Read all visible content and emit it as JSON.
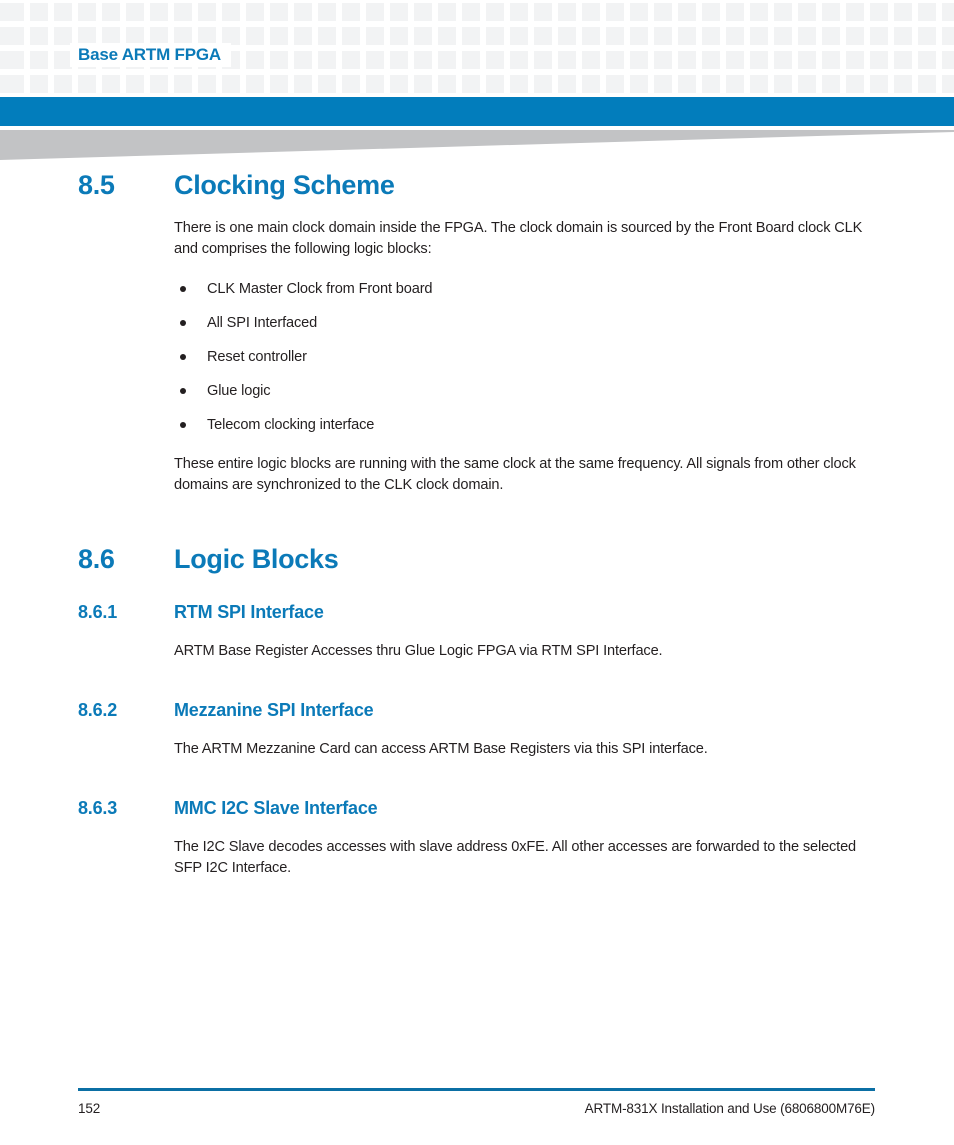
{
  "document": {
    "header": {
      "running_title": "Base ARTM FPGA"
    },
    "footer": {
      "page_number": "152",
      "doc_info": "ARTM-831X Installation and Use (6806800M76E)"
    },
    "colors": {
      "heading_blue": "#0b7ab8",
      "header_bar_blue": "#027dbc",
      "footer_rule_blue": "#0b6fa4",
      "wedge_gray": "#c2c3c5",
      "pattern_gray": "#f2f3f4",
      "body_text": "#231f20"
    },
    "sections": [
      {
        "number": "8.5",
        "title": "Clocking Scheme",
        "intro": "There is one main clock domain inside the FPGA. The clock domain is sourced by the Front Board clock CLK and comprises the following logic blocks:",
        "bullets": [
          "CLK Master Clock from Front board",
          "All SPI Interfaced",
          "Reset controller",
          "Glue logic",
          "Telecom clocking interface"
        ],
        "outro": "These entire logic blocks are running with the same clock at the same frequency. All signals from other clock domains are synchronized to the CLK clock domain."
      },
      {
        "number": "8.6",
        "title": "Logic Blocks",
        "subsections": [
          {
            "number": "8.6.1",
            "title": "RTM SPI Interface",
            "body": "ARTM Base Register Accesses thru Glue Logic FPGA via RTM SPI Interface."
          },
          {
            "number": "8.6.2",
            "title": "Mezzanine SPI Interface",
            "body": "The ARTM Mezzanine Card can access ARTM Base Registers via this SPI interface."
          },
          {
            "number": "8.6.3",
            "title": "MMC I2C Slave Interface",
            "body": "The I2C Slave decodes accesses with slave address 0xFE. All other accesses are forwarded to the selected SFP I2C Interface."
          }
        ]
      }
    ]
  }
}
